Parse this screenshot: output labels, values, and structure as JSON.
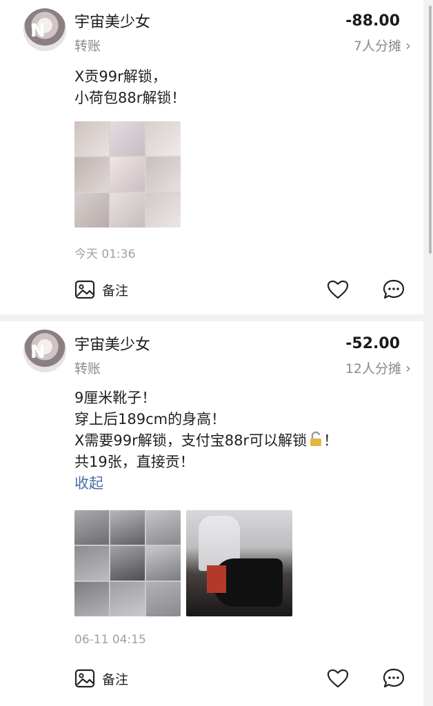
{
  "posts": [
    {
      "user": "宇宙美少女",
      "type": "转账",
      "amount": "-88.00",
      "share": "7人分摊",
      "lines": [
        "X贡99r解锁，",
        "小荷包88r解锁！"
      ],
      "time": "今天 01:36",
      "note_label": "备注"
    },
    {
      "user": "宇宙美少女",
      "type": "转账",
      "amount": "-52.00",
      "share": "12人分摊",
      "lines": [
        "9厘米靴子！",
        "穿上后189cm的身高！",
        "X需要99r解锁，支付宝88r可以解锁",
        "共19张，直接贡！"
      ],
      "lock_icon": "lock-emoji",
      "collapse_label": "收起",
      "time": "06-11 04:15",
      "note_label": "备注"
    }
  ],
  "colors": {
    "link": "#4a6ea2",
    "muted": "#8a8a8a",
    "bg": "#f2f2f2"
  }
}
